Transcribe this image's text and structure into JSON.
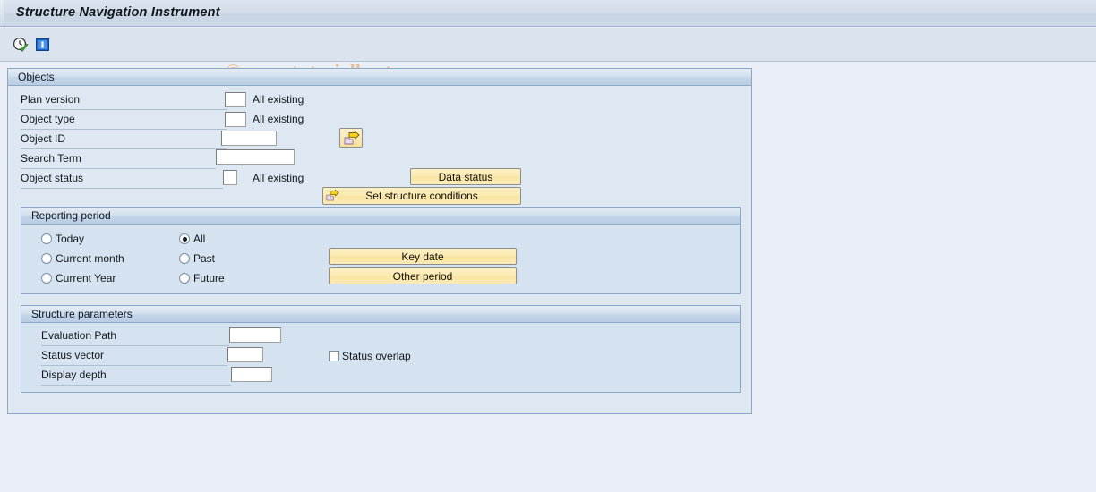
{
  "window": {
    "title": "Structure Navigation Instrument"
  },
  "toolbar": {
    "icons": [
      {
        "name": "execute-clock-icon",
        "title": "Execute"
      },
      {
        "name": "information-icon",
        "title": "Information"
      }
    ]
  },
  "watermark": {
    "text": "© www.tutorialkart.com",
    "color": "#e7b784"
  },
  "objects": {
    "group_title": "Objects",
    "fields": [
      {
        "label": "Plan version",
        "value": "",
        "suffix": "All existing"
      },
      {
        "label": "Object type",
        "value": "",
        "suffix": "All existing"
      },
      {
        "label": "Object ID",
        "value": "",
        "suffix": ""
      },
      {
        "label": "Search  Term",
        "value": "",
        "suffix": ""
      },
      {
        "label": "Object status",
        "value": "",
        "suffix": "All existing"
      }
    ],
    "multi_select_button": {
      "label": "",
      "icon": "arrow-right-folder-icon"
    },
    "data_status_button": "Data status",
    "set_structure_conditions_button": {
      "label": "Set structure conditions",
      "icon": "arrow-right-folder-icon"
    }
  },
  "reporting_period": {
    "group_title": "Reporting period",
    "options_left": [
      {
        "label": "Today",
        "selected": false
      },
      {
        "label": "Current month",
        "selected": false
      },
      {
        "label": "Current Year",
        "selected": false
      }
    ],
    "options_right": [
      {
        "label": "All",
        "selected": true
      },
      {
        "label": "Past",
        "selected": false
      },
      {
        "label": "Future",
        "selected": false
      }
    ],
    "key_date_button": "Key date",
    "other_period_button": "Other period"
  },
  "structure_parameters": {
    "group_title": "Structure parameters",
    "fields": [
      {
        "label": "Evaluation Path",
        "value": ""
      },
      {
        "label": "Status vector",
        "value": ""
      },
      {
        "label": "Display depth",
        "value": ""
      }
    ],
    "status_overlap_checkbox": {
      "label": "Status overlap",
      "checked": false
    }
  },
  "theme": {
    "accent_button": "#fbe9ae",
    "panel_bg": "#dee8f2",
    "subgroup_bg": "#d5e3f0",
    "window_bg": "#eaeff7",
    "border": "#8ba8c6"
  }
}
